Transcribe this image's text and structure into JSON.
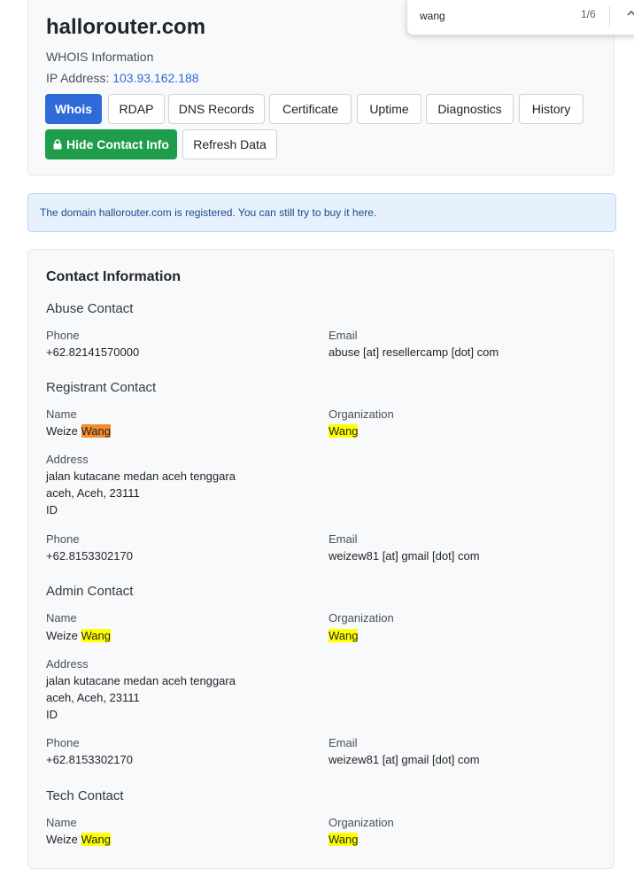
{
  "domain": "hallorouter.com",
  "subtitle": "WHOIS Information",
  "ip_label": "IP Address:",
  "ip_value": "103.93.162.188",
  "tabs": [
    "Whois",
    "RDAP",
    "DNS Records",
    "Certificate",
    "Uptime",
    "Diagnostics",
    "History"
  ],
  "actions": {
    "hide_contact": "Hide Contact Info",
    "refresh": "Refresh Data"
  },
  "alert": {
    "prefix": "The domain",
    "domain": "hallorouter.com",
    "middle": "is registered. You can still try to buy it",
    "link": "here",
    "suffix": "."
  },
  "find": {
    "query": "wang",
    "count": "1/6"
  },
  "contact": {
    "title": "Contact Information",
    "labels": {
      "name": "Name",
      "organization": "Organization",
      "address": "Address",
      "phone": "Phone",
      "email": "Email"
    },
    "abuse": {
      "title": "Abuse Contact",
      "phone": "+62.82141570000",
      "email": "abuse [at] resellercamp [dot] com"
    },
    "registrant": {
      "title": "Registrant Contact",
      "name_first": "Weize",
      "name_last": "Wang",
      "organization": "Wang",
      "address": [
        "jalan kutacane medan aceh tenggara",
        "aceh, Aceh, 23111",
        "ID"
      ],
      "phone": "+62.8153302170",
      "email": "weizew81 [at] gmail [dot] com"
    },
    "admin": {
      "title": "Admin Contact",
      "name_first": "Weize",
      "name_last": "Wang",
      "organization": "Wang",
      "address": [
        "jalan kutacane medan aceh tenggara",
        "aceh, Aceh, 23111",
        "ID"
      ],
      "phone": "+62.8153302170",
      "email": "weizew81 [at] gmail [dot] com"
    },
    "tech": {
      "title": "Tech Contact",
      "name_first": "Weize",
      "name_last": "Wang",
      "organization": "Wang"
    }
  },
  "colors": {
    "primary": "#2f6bd8",
    "success": "#1e9e4a",
    "highlight": "#ffff00",
    "active_highlight": "#f48c2c"
  }
}
